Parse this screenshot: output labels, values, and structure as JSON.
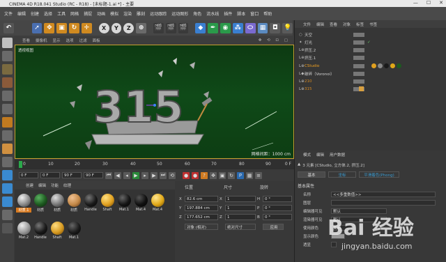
{
  "title_bar": {
    "title": "CINEMA 4D R18.041 Studio (RC - R18) - [未标题-1.ai *] - 主要"
  },
  "menu": [
    "文件",
    "编辑",
    "创建",
    "选择",
    "工具",
    "网格",
    "捕捉",
    "动画",
    "模拟",
    "渲染",
    "雕刻",
    "运动跟踪",
    "运动图形",
    "角色",
    "流水线",
    "插件",
    "脚本",
    "窗口",
    "帮助"
  ],
  "toolbar": {
    "axis_x": "X",
    "axis_y": "Y",
    "axis_z": "Z"
  },
  "viewport": {
    "menu": [
      "查看",
      "摄像机",
      "显示",
      "选项",
      "过滤",
      "面板"
    ],
    "label": "透视视图",
    "grid_distance": "网格间距：1000 cm",
    "text_3d": "315"
  },
  "timeline": {
    "ticks": [
      "0",
      "10",
      "20",
      "30",
      "40",
      "50",
      "60",
      "70",
      "80",
      "90"
    ],
    "frame_end": "0 F"
  },
  "transport": {
    "start": "0 F",
    "current": "0 F",
    "end_a": "90 F",
    "end_b": "90 F"
  },
  "materials": {
    "menu": [
      "创建",
      "编辑",
      "功能",
      "纹理"
    ],
    "items": [
      {
        "label": "材质.1",
        "color": "#8a8a8a"
      },
      {
        "label": "材质",
        "color": "#1d5a20"
      },
      {
        "label": "材质",
        "color": "#777777"
      },
      {
        "label": "材质",
        "color": "#c48a4a"
      },
      {
        "label": "Handle",
        "color": "#1a1a1a"
      },
      {
        "label": "Shaft",
        "color": "#e0a020"
      },
      {
        "label": "Mat.1",
        "color": "#151515"
      },
      {
        "label": "Mat.4",
        "color": "#101010"
      },
      {
        "label": "Mat.4",
        "color": "#e0a818"
      },
      {
        "label": "Mat.2",
        "color": "#999999"
      },
      {
        "label": "Handle",
        "color": "#1a1a1a"
      },
      {
        "label": "Shaft",
        "color": "#d69a22"
      },
      {
        "label": "Mat.1",
        "color": "#1c1c1c"
      }
    ]
  },
  "coordinates": {
    "headers": {
      "position": "位置",
      "size": "尺寸",
      "rotation": "旋转"
    },
    "rows": [
      {
        "axis": "X",
        "pos": "82.6 cm",
        "size_axis": "X",
        "size": "1",
        "rot_axis": "H",
        "rot": "0 °"
      },
      {
        "axis": "Y",
        "pos": "197.884 cm",
        "size_axis": "Y",
        "size": "1",
        "rot_axis": "P",
        "rot": "0 °"
      },
      {
        "axis": "Z",
        "pos": "177.652 cm",
        "size_axis": "Z",
        "size": "1",
        "rot_axis": "B",
        "rot": "0 °"
      }
    ],
    "mode_object": "对象 (相对)",
    "mode_size": "绝对尺寸",
    "apply": "应用"
  },
  "objects": {
    "menu": [
      "文件",
      "编辑",
      "查看",
      "对象",
      "标签",
      "书签"
    ],
    "items": [
      {
        "name": "天空",
        "color": "#cfcfcf"
      },
      {
        "name": "灯光",
        "color": "#cfcfcf"
      },
      {
        "name": "挤压.2",
        "color": "#cfcfcf"
      },
      {
        "name": "挤压.1",
        "color": "#cfcfcf"
      },
      {
        "name": "CStudio",
        "color": "#f0a020"
      },
      {
        "name": "破碎（Voronoi）",
        "color": "#cfcfcf"
      },
      {
        "name": "210",
        "color": "#d88a20"
      },
      {
        "name": "315",
        "color": "#d88a20"
      }
    ]
  },
  "attributes": {
    "menu": [
      "模式",
      "编辑",
      "用户数据"
    ],
    "header": "3 元素 [CStudio, 立方体.2, 挤压.2]",
    "tabs": [
      "基本",
      "坐标",
      "平滑着色(Phong)"
    ],
    "section": "基本属性",
    "rows": [
      {
        "label": "名称",
        "value": "<<多重数值>>"
      },
      {
        "label": "图层",
        "value": ""
      },
      {
        "label": "编辑器可见",
        "value": "默认"
      },
      {
        "label": "渲染器可见",
        "value": "默认"
      },
      {
        "label": "使用颜色",
        "value": "关闭"
      },
      {
        "label": "显示颜色",
        "value": ""
      },
      {
        "label": "透显",
        "value": ""
      }
    ]
  },
  "watermark": {
    "brand": "Bai 经验",
    "url": "jingyan.baidu.com"
  }
}
